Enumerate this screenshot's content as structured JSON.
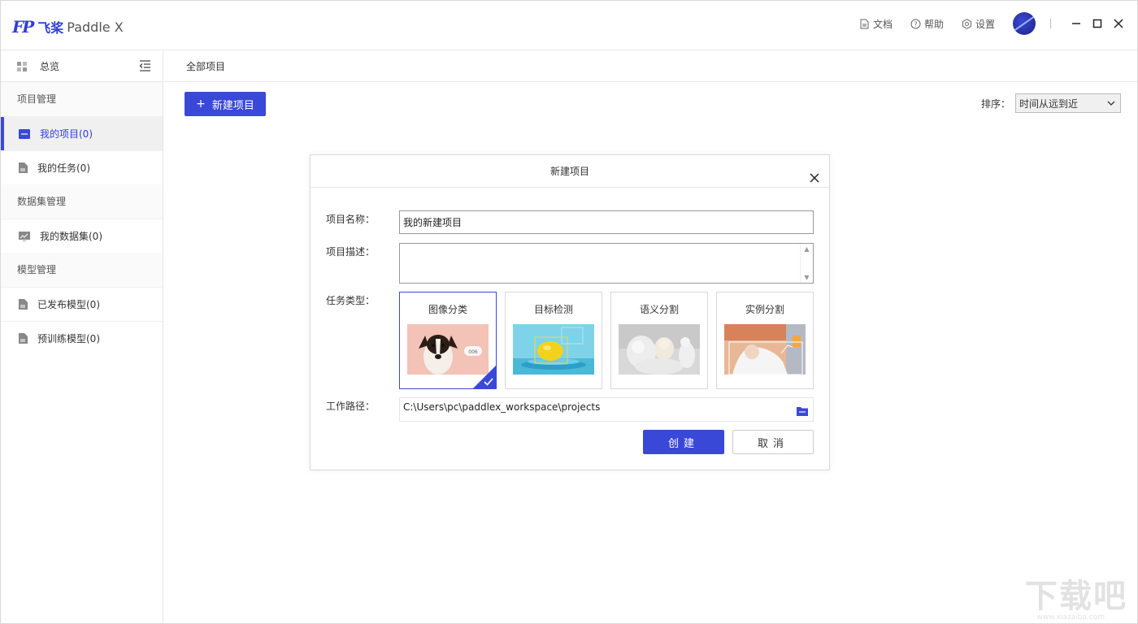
{
  "app": {
    "logo_mark": "FP",
    "logo_cn": "飞桨",
    "logo_en": "Paddle X"
  },
  "topbar": {
    "docs": "文档",
    "help": "帮助",
    "settings": "设置"
  },
  "sidebar": {
    "overview": "总览",
    "groups": [
      {
        "title": "项目管理",
        "items": [
          {
            "label": "我的项目(0)",
            "active": true
          },
          {
            "label": "我的任务(0)"
          }
        ]
      },
      {
        "title": "数据集管理",
        "items": [
          {
            "label": "我的数据集(0)"
          }
        ]
      },
      {
        "title": "模型管理",
        "items": [
          {
            "label": "已发布模型(0)"
          },
          {
            "label": "预训练模型(0)"
          }
        ]
      }
    ]
  },
  "main": {
    "header": "全部项目",
    "new_button": "新建项目",
    "sort_label": "排序：",
    "sort_value": "时间从远到近"
  },
  "dialog": {
    "title": "新建项目",
    "name_label": "项目名称：",
    "name_value": "我的新建项目",
    "desc_label": "项目描述：",
    "desc_value": "",
    "task_label": "任务类型：",
    "tasks": [
      {
        "label": "图像分类",
        "selected": true,
        "badge": "006"
      },
      {
        "label": "目标检测"
      },
      {
        "label": "语义分割"
      },
      {
        "label": "实例分割"
      }
    ],
    "path_label": "工作路径：",
    "path_value": "C:\\Users\\pc\\paddlex_workspace\\projects",
    "create": "创建",
    "cancel": "取消"
  },
  "watermark": {
    "text": "下载吧",
    "sub": "www.xiazaiba.com"
  },
  "colors": {
    "accent": "#3a48d8"
  }
}
